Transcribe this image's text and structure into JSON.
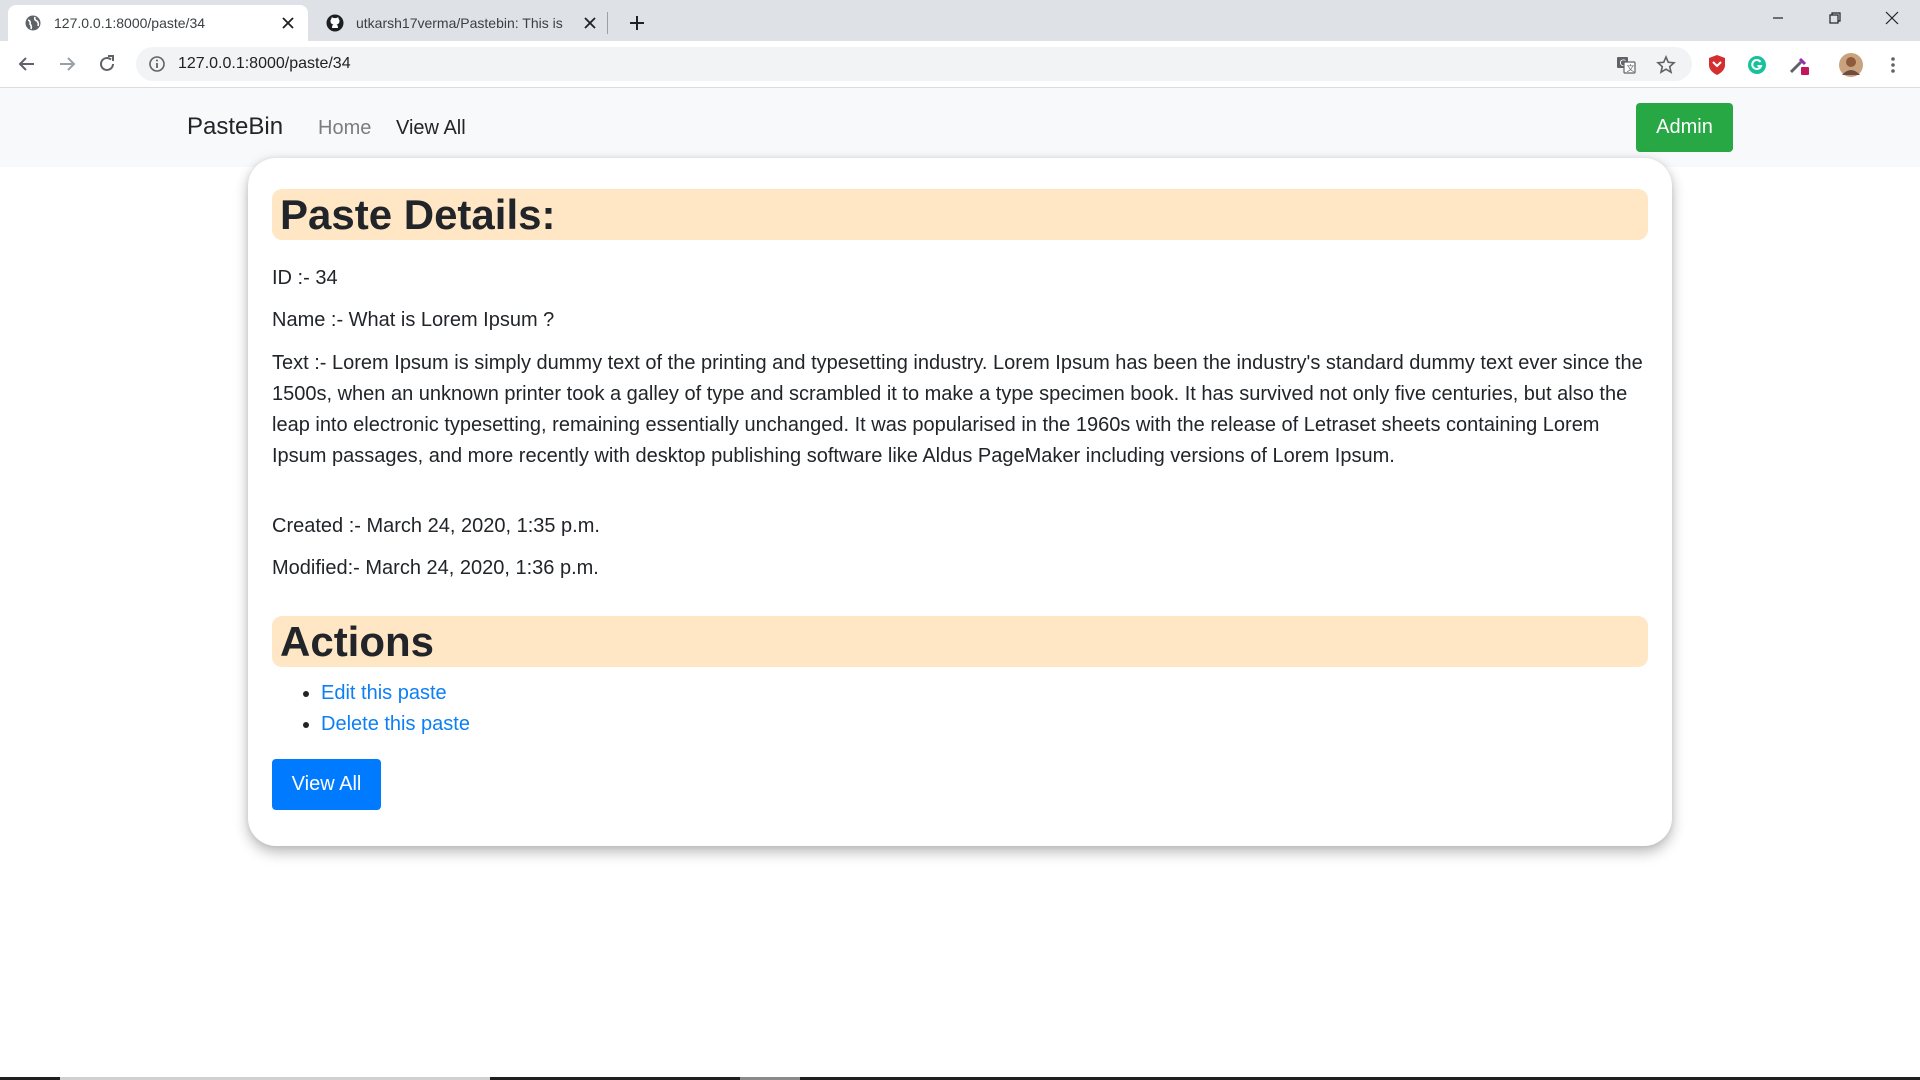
{
  "browser": {
    "tabs": [
      {
        "title": "127.0.0.1:8000/paste/34",
        "icon": "globe-icon",
        "active": true
      },
      {
        "title": "utkarsh17verma/Pastebin: This is",
        "icon": "github-icon",
        "active": false
      }
    ],
    "url": "127.0.0.1:8000/paste/34",
    "extensions": [
      "translate-icon",
      "bookmark-star-icon",
      "shield-extension-icon",
      "grammarly-icon",
      "eyedropper-extension-icon",
      "profile-avatar-icon",
      "kebab-menu-icon"
    ]
  },
  "navbar": {
    "brand": "PasteBin",
    "links": [
      {
        "label": "Home"
      },
      {
        "label": "View All"
      }
    ],
    "admin_label": "Admin",
    "admin_color": "#28a745"
  },
  "paste": {
    "heading": "Paste Details:",
    "id_line": "ID :- 34",
    "name_line": "Name :- What is Lorem Ipsum ?",
    "text_line": "Text :- Lorem Ipsum is simply dummy text of the printing and typesetting industry. Lorem Ipsum has been the industry's standard dummy text ever since the 1500s, when an unknown printer took a galley of type and scrambled it to make a type specimen book. It has survived not only five centuries, but also the leap into electronic typesetting, remaining essentially unchanged. It was popularised in the 1960s with the release of Letraset sheets containing Lorem Ipsum passages, and more recently with desktop publishing software like Aldus PageMaker including versions of Lorem Ipsum.",
    "created_line": "Created :- March 24, 2020, 1:35 p.m.",
    "modified_line": "Modified:- March 24, 2020, 1:36 p.m."
  },
  "actions": {
    "heading": "Actions",
    "links": [
      {
        "label": "Edit this paste"
      },
      {
        "label": "Delete this paste"
      }
    ],
    "view_all_label": "View All",
    "view_all_color": "#007bff"
  },
  "colors": {
    "section_heading_bg": "#ffe7c6",
    "link": "#0d7ff5"
  }
}
